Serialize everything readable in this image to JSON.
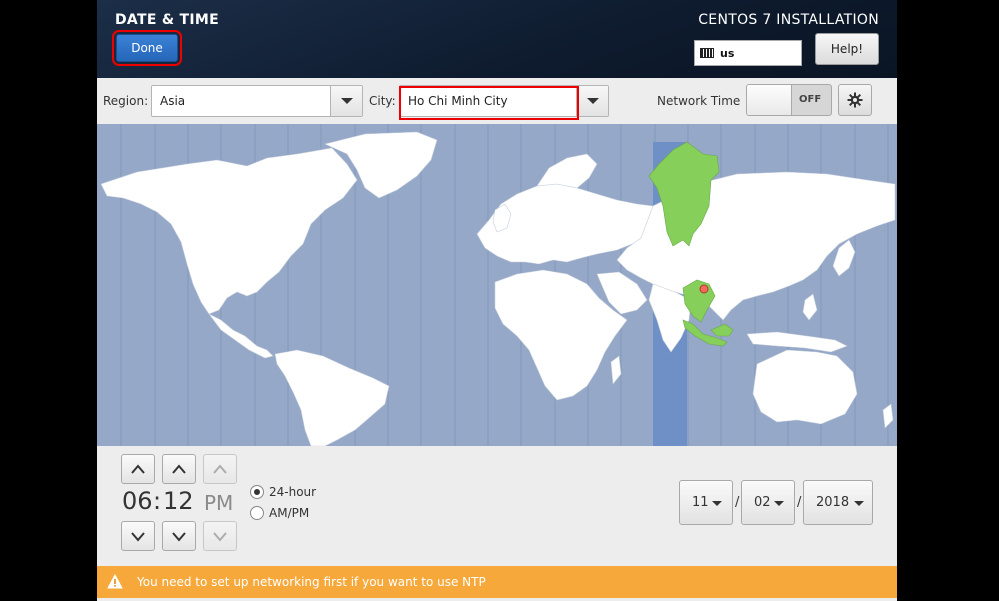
{
  "header": {
    "title": "DATE & TIME",
    "done_label": "Done",
    "install_title": "CENTOS 7 INSTALLATION",
    "keyboard_layout": "us",
    "help_label": "Help!"
  },
  "toolbar": {
    "region_label": "Region:",
    "region_value": "Asia",
    "city_label": "City:",
    "city_value": "Ho Chi Minh City",
    "network_time_label": "Network Time",
    "network_time_state": "OFF"
  },
  "time": {
    "hours": "06",
    "separator": ":",
    "minutes": "12",
    "ampm": "PM",
    "format_24h_label": "24-hour",
    "format_ampm_label": "AM/PM",
    "selected_format": "24-hour"
  },
  "date": {
    "month": "11",
    "day": "02",
    "year": "2018",
    "separator": "/"
  },
  "warning": {
    "text": "You need to set up networking first if you want to use NTP"
  },
  "colors": {
    "ocean": "#95a8c8",
    "land": "#ffffff",
    "selected_zone": "#86cf5a",
    "zone_band": "#6f8fc7",
    "warning_bg": "#f7a83b",
    "done_bg": "#2f74c7"
  },
  "icons": {
    "keyboard": "keyboard-icon",
    "gear": "gear-icon",
    "warning": "warning-icon",
    "chevron_up": "chevron-up-icon",
    "chevron_down": "chevron-down-icon"
  }
}
